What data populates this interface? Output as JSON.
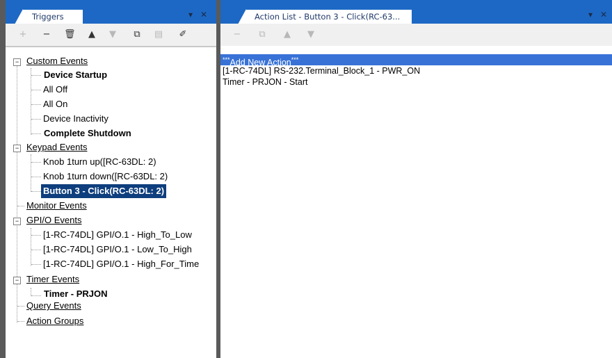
{
  "triggers_panel": {
    "title": "Triggers",
    "toolbar": [
      {
        "name": "add-button",
        "icon": "plus-icon",
        "glyph": "+",
        "enabled": false
      },
      {
        "name": "remove-button",
        "icon": "minus-icon",
        "glyph": "−",
        "enabled": true
      },
      {
        "name": "delete-button",
        "icon": "trash-icon",
        "glyph": "🗑",
        "enabled": true
      },
      {
        "name": "move-up-button",
        "icon": "triangle-up-icon",
        "glyph": "▲",
        "enabled": true
      },
      {
        "name": "move-down-button",
        "icon": "triangle-down-icon",
        "glyph": "▼",
        "enabled": false
      },
      {
        "name": "copy-button",
        "icon": "copy-icon",
        "glyph": "⧉",
        "enabled": true
      },
      {
        "name": "paste-button",
        "icon": "paste-icon",
        "glyph": "▤",
        "enabled": false
      },
      {
        "name": "rename-button",
        "icon": "eraser-icon",
        "glyph": "✐",
        "enabled": true
      }
    ],
    "tree": {
      "custom_events": {
        "label": "Custom Events",
        "children": [
          "Device Startup",
          "All Off",
          "All On",
          "Device Inactivity",
          "Complete Shutdown"
        ]
      },
      "keypad_events": {
        "label": "Keypad Events",
        "children": [
          "Knob 1turn up([RC-63DL: 2)",
          "Knob 1turn down([RC-63DL: 2)",
          "Button 3 - Click(RC-63DL: 2)"
        ]
      },
      "monitor_events": {
        "label": "Monitor Events"
      },
      "gpio_events": {
        "label": "GPI/O Events",
        "children": [
          "[1-RC-74DL] GPI/O.1 - High_To_Low",
          "[1-RC-74DL] GPI/O.1 - Low_To_High",
          "[1-RC-74DL] GPI/O.1 - High_For_Time"
        ]
      },
      "timer_events": {
        "label": "Timer Events",
        "children": [
          "Timer - PRJON"
        ]
      },
      "query_events": {
        "label": "Query Events"
      },
      "action_groups": {
        "label": "Action Groups"
      }
    }
  },
  "action_panel": {
    "title": "Action List - Button 3 - Click(RC-63...",
    "toolbar": [
      {
        "name": "remove-action-button",
        "icon": "minus-icon",
        "glyph": "−",
        "enabled": false
      },
      {
        "name": "copy-action-button",
        "icon": "copy-icon",
        "glyph": "⧉",
        "enabled": false
      },
      {
        "name": "move-action-up-button",
        "icon": "triangle-up-icon",
        "glyph": "▲",
        "enabled": false
      },
      {
        "name": "move-action-down-button",
        "icon": "triangle-down-icon",
        "glyph": "▼",
        "enabled": false
      }
    ],
    "rows": {
      "add_prefix": "***",
      "add_text": "Add New Action",
      "add_suffix": "***",
      "action1": "[1-RC-74DL] RS-232.Terminal_Block_1 - PWR_ON",
      "action2": "Timer - PRJON - Start"
    }
  },
  "panel_controls": {
    "dropdown": "▾",
    "close": "✕"
  },
  "colors": {
    "accent": "#1d68c4",
    "selection": "#0e3e7d",
    "row_selected": "#3872d6"
  }
}
